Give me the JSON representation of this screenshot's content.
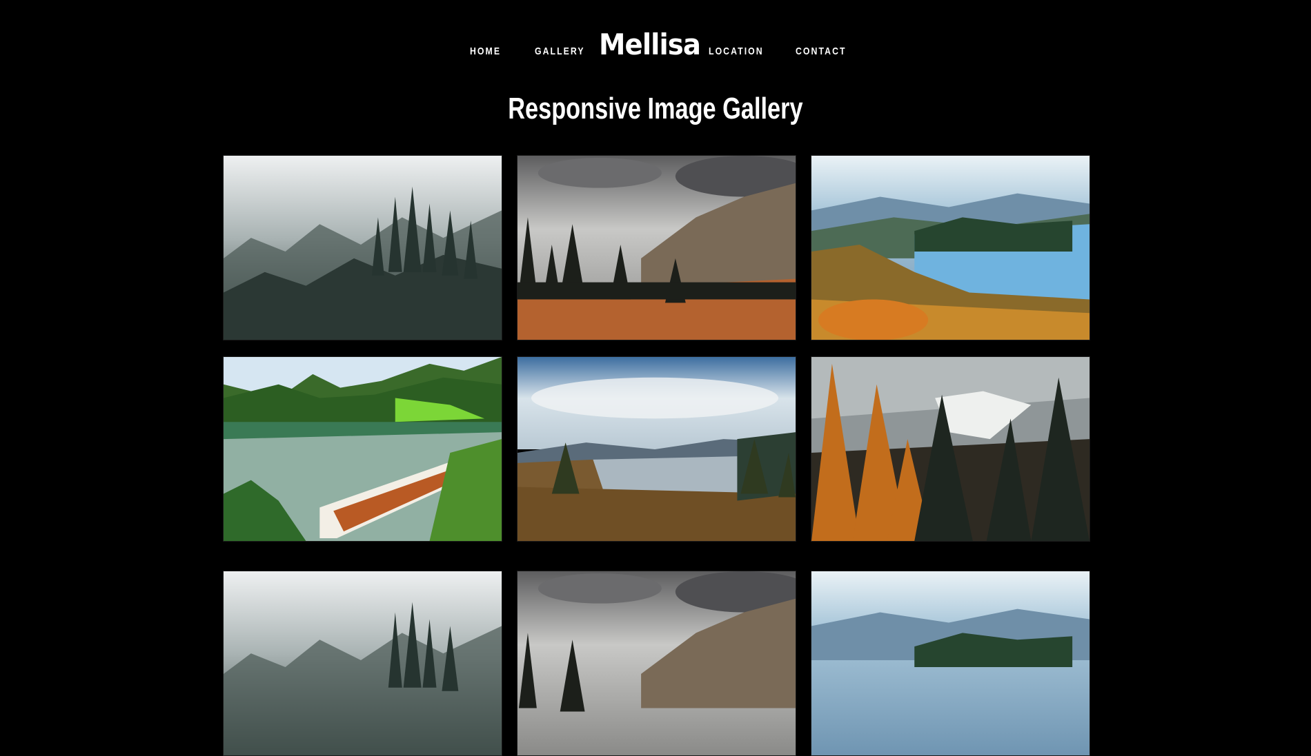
{
  "nav": {
    "home": "HOME",
    "gallery": "GALLERY",
    "logo": "Mellisa",
    "location": "LOCATION",
    "contact": "CONTACT"
  },
  "page": {
    "title": "Responsive Image Gallery"
  },
  "gallery": {
    "images": [
      {
        "name": "misty-forest"
      },
      {
        "name": "mountain-pines"
      },
      {
        "name": "autumn-lake-castle"
      },
      {
        "name": "boat-on-lake"
      },
      {
        "name": "mountain-lake-meadow"
      },
      {
        "name": "orange-larches"
      },
      {
        "name": "misty-forest"
      },
      {
        "name": "mountain-pines"
      },
      {
        "name": "autumn-lake-castle"
      }
    ]
  }
}
